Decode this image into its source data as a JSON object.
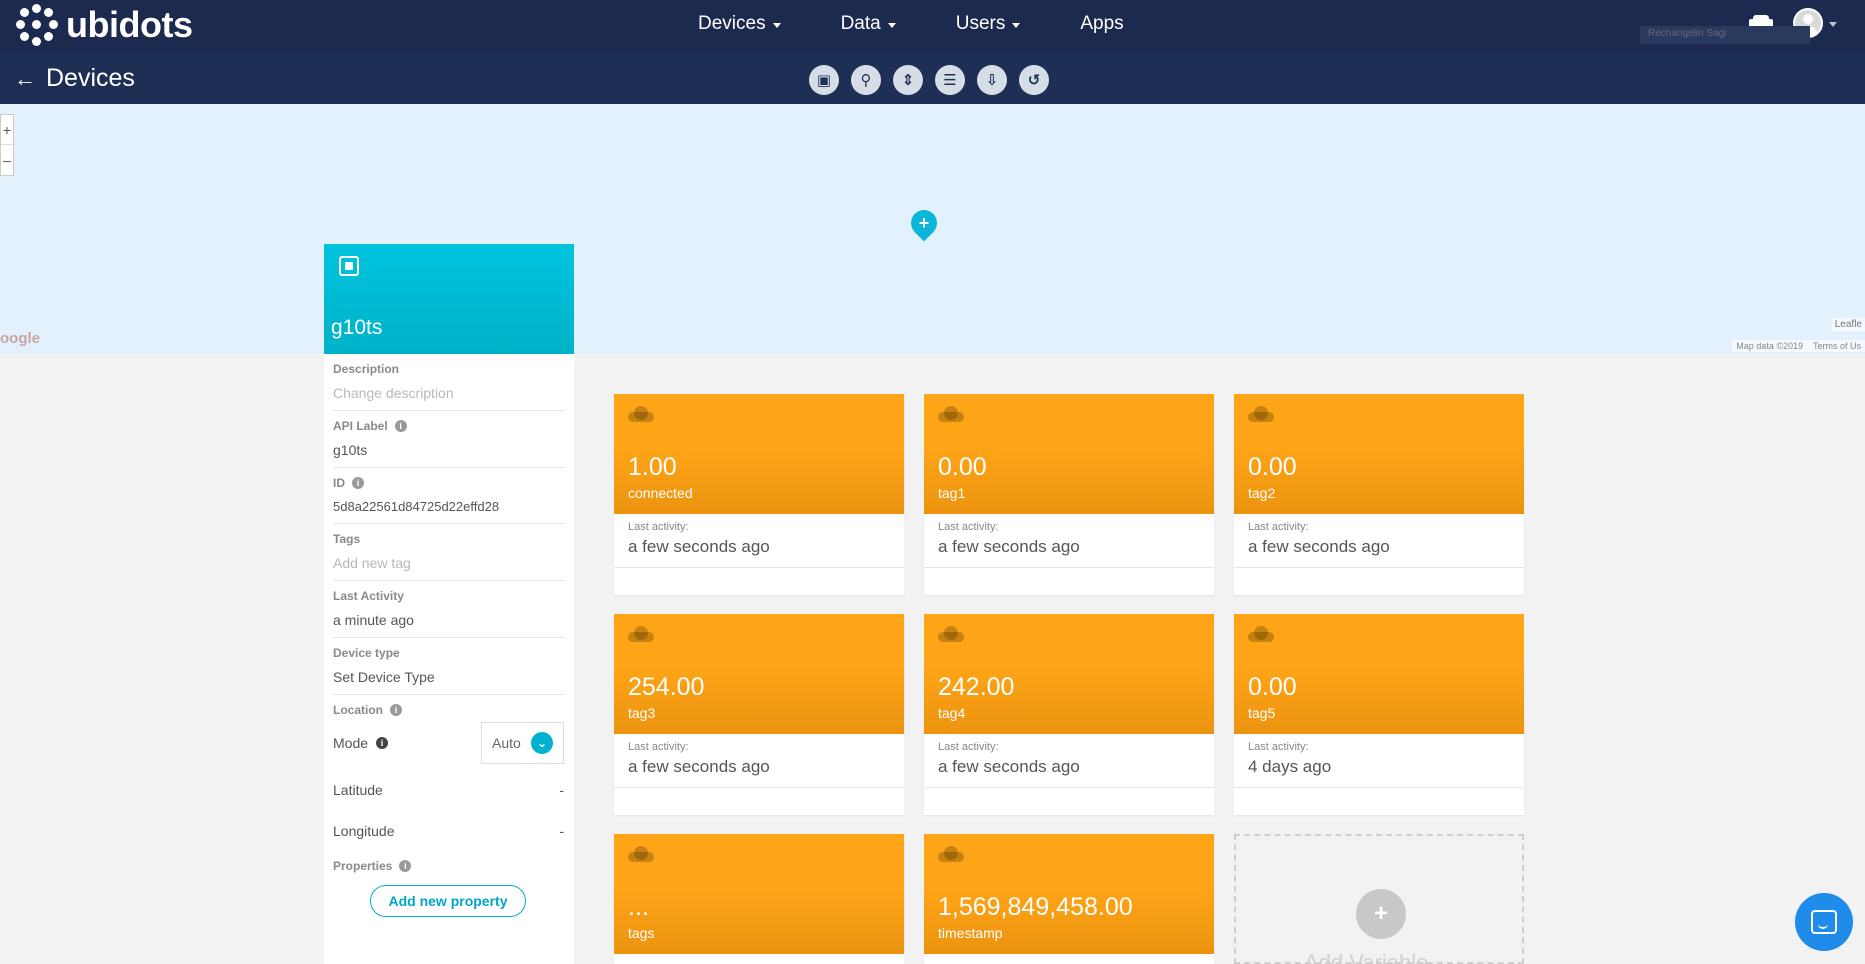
{
  "app": {
    "brand": "ubidots"
  },
  "nav": {
    "items": [
      {
        "label": "Devices",
        "has_caret": true
      },
      {
        "label": "Data",
        "has_caret": true
      },
      {
        "label": "Users",
        "has_caret": true
      },
      {
        "label": "Apps",
        "has_caret": false
      }
    ]
  },
  "subbar": {
    "back_label": "Devices",
    "back_icon": "arrow-left-icon",
    "tools": [
      "chip-icon",
      "search-icon",
      "sort-icon",
      "list-icon",
      "download-icon",
      "refresh-icon"
    ]
  },
  "map": {
    "google": "oogle",
    "leaflet": "Leafle",
    "map_data": "Map data ©2019",
    "terms": "Terms of Us",
    "satellite": "Rechangelin Sagi"
  },
  "device": {
    "name": "g10ts",
    "description_label": "Description",
    "description_placeholder": "Change description",
    "api_label_label": "API Label",
    "api_label": "g10ts",
    "id_label": "ID",
    "id": "5d8a22561d84725d22effd28",
    "tags_label": "Tags",
    "tags_placeholder": "Add new tag",
    "last_activity_label": "Last Activity",
    "last_activity": "a minute ago",
    "device_type_label": "Device type",
    "device_type": "Set Device Type",
    "location_label": "Location",
    "mode_label": "Mode",
    "mode_value": "Auto",
    "latitude_label": "Latitude",
    "latitude_value": "-",
    "longitude_label": "Longitude",
    "longitude_value": "-",
    "properties_label": "Properties",
    "add_property": "Add new property"
  },
  "variables": [
    {
      "value": "1.00",
      "name": "connected",
      "last_activity_label": "Last activity:",
      "last_activity": "a few seconds ago"
    },
    {
      "value": "0.00",
      "name": "tag1",
      "last_activity_label": "Last activity:",
      "last_activity": "a few seconds ago"
    },
    {
      "value": "0.00",
      "name": "tag2",
      "last_activity_label": "Last activity:",
      "last_activity": "a few seconds ago"
    },
    {
      "value": "254.00",
      "name": "tag3",
      "last_activity_label": "Last activity:",
      "last_activity": "a few seconds ago"
    },
    {
      "value": "242.00",
      "name": "tag4",
      "last_activity_label": "Last activity:",
      "last_activity": "a few seconds ago"
    },
    {
      "value": "0.00",
      "name": "tag5",
      "last_activity_label": "Last activity:",
      "last_activity": "4 days ago"
    },
    {
      "value": "...",
      "name": "tags",
      "last_activity_label": "",
      "last_activity": ""
    },
    {
      "value": "1,569,849,458.00",
      "name": "timestamp",
      "last_activity_label": "",
      "last_activity": ""
    }
  ],
  "add_variable": {
    "label": "Add Variable"
  },
  "colors": {
    "navbar": "#1b2a4e",
    "subbar": "#1e2f55",
    "device_header": "#00b8d4",
    "variable_card": "#fda417",
    "accent": "#00b2cf",
    "chat": "#1f8ceb"
  }
}
